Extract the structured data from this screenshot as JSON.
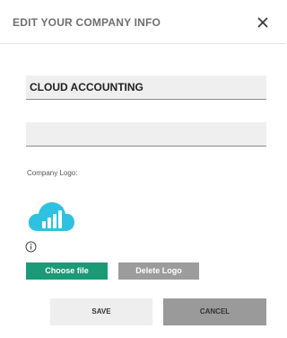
{
  "dialog": {
    "title": "EDIT YOUR COMPANY INFO",
    "close_icon": "close-icon"
  },
  "form": {
    "company_name_value": "CLOUD ACCOUNTING",
    "second_field_value": "",
    "logo_label": "Company Logo:",
    "logo_icon": "cloud-chart-logo",
    "info_icon": "info-circle-icon"
  },
  "logo_buttons": {
    "choose_label": "Choose file",
    "delete_label": "Delete Logo"
  },
  "actions": {
    "save_label": "SAVE",
    "cancel_label": "CANCEL"
  },
  "colors": {
    "choose_button": "#1a9a76",
    "delete_button": "#9c9c9c",
    "logo_cloud": "#2fc2e0"
  }
}
